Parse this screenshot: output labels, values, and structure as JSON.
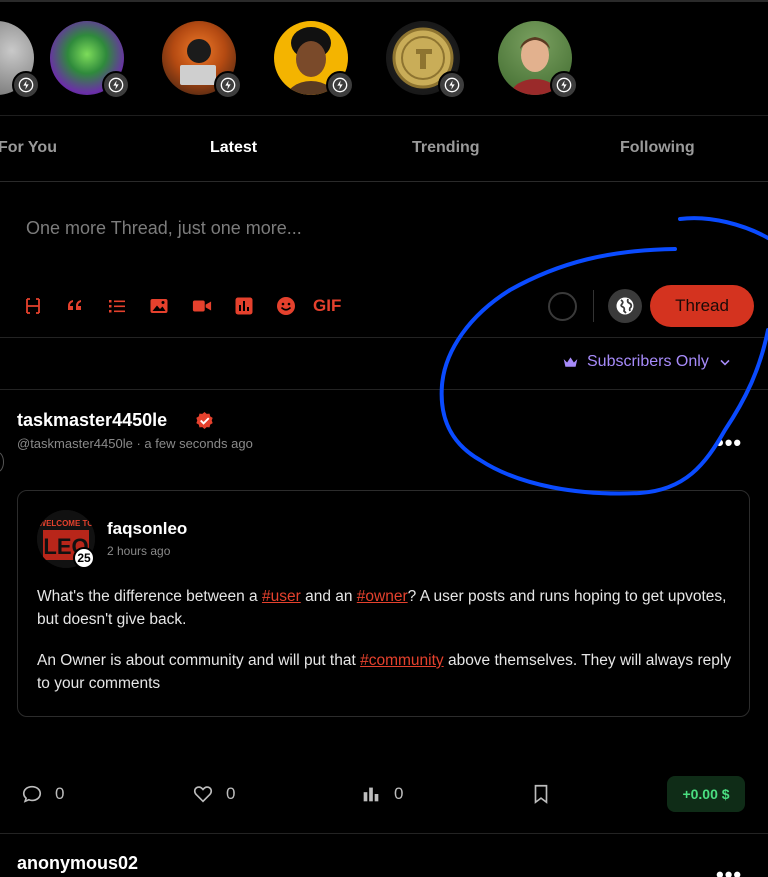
{
  "stories": [
    {
      "name": "story-partial",
      "color": "#8d8d8d"
    },
    {
      "name": "story-hulk",
      "color": "#3fa34d"
    },
    {
      "name": "story-hacker",
      "color": "#e5762b"
    },
    {
      "name": "story-woman",
      "color": "#f4b400"
    },
    {
      "name": "story-coin",
      "color": "#b89a42"
    },
    {
      "name": "story-man",
      "color": "#5a8a4a"
    }
  ],
  "tabs": {
    "for_you": "For You",
    "latest": "Latest",
    "trending": "Trending",
    "following": "Following"
  },
  "composer": {
    "placeholder": "One more Thread, just one more...",
    "gif_label": "GIF",
    "submit_label": "Thread"
  },
  "visibility": {
    "label": "Subscribers Only"
  },
  "post": {
    "username": "taskmaster4450le",
    "handle": "@taskmaster4450le",
    "time": "a few seconds ago",
    "more": "•••",
    "quote": {
      "username": "faqsonleo",
      "time": "2 hours ago",
      "level": "25",
      "avatar_text": "WELCOME TO LEO",
      "p1_a": "What's the difference between a ",
      "tag1": "#user",
      "p1_b": " and an ",
      "tag2": "#owner",
      "p1_c": "? A user posts and runs hoping to get upvotes, but doesn't give back.",
      "p2_a": "An Owner is about community and will put that ",
      "tag3": "#community",
      "p2_b": " above themselves. They will always reply to your comments"
    },
    "actions": {
      "comments": "0",
      "likes": "0",
      "views": "0",
      "payout": "+0.00 $"
    }
  },
  "next_post": {
    "username": "anonymous02",
    "more": "•••"
  },
  "colors": {
    "accent": "#e5412d",
    "button": "#d4331f",
    "subscribers": "#a78bfa",
    "payout_bg": "#0f2c17",
    "payout_text": "#4ade80",
    "annotation": "#0a4bff"
  }
}
